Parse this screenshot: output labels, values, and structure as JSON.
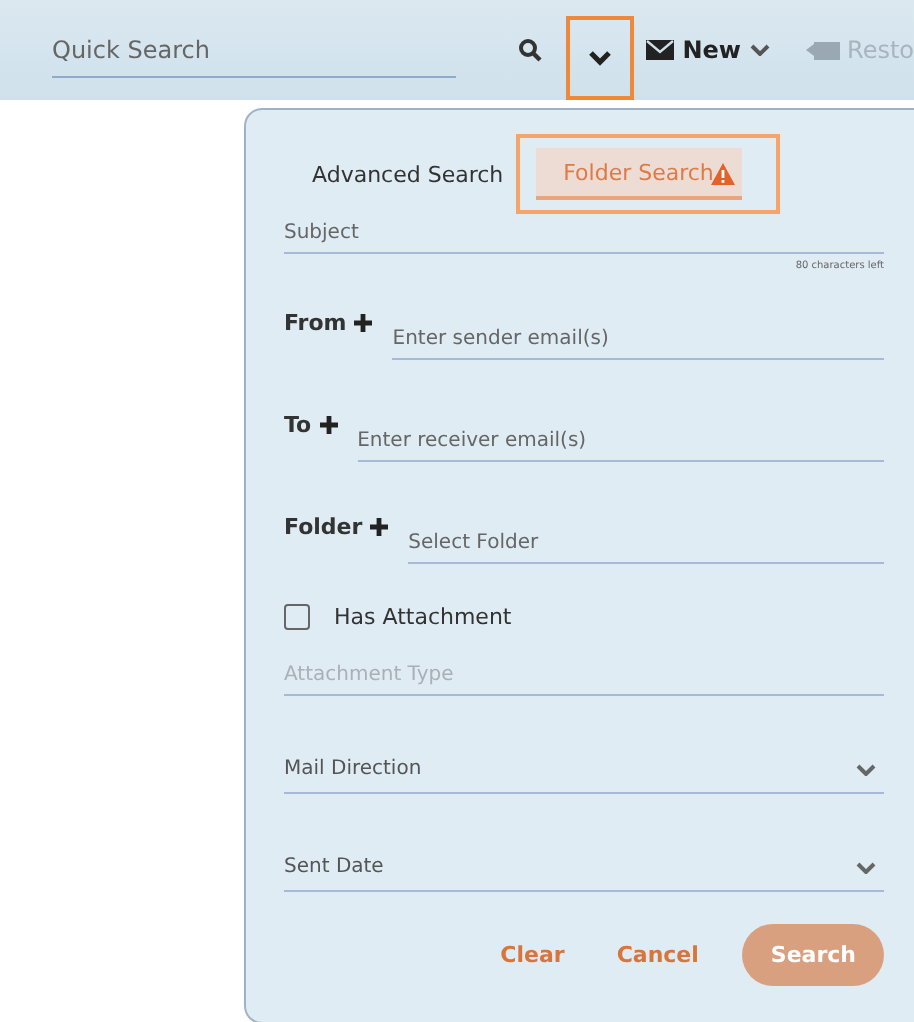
{
  "toolbar": {
    "quick_search": {
      "placeholder": "Quick Search"
    },
    "dropdown_button": {
      "highlighted": true
    },
    "new_button": {
      "label": "New"
    },
    "restore_button": {
      "label": "Resto",
      "disabled": true
    }
  },
  "panel": {
    "tabs": [
      {
        "label": "Advanced Search",
        "selected": false,
        "highlighted": false,
        "warning": false
      },
      {
        "label": "Folder Search",
        "selected": true,
        "highlighted": true,
        "warning": true
      }
    ],
    "subject": {
      "placeholder": "Subject",
      "counter": "80 characters left"
    },
    "fields": [
      {
        "kind": "input",
        "label": "From",
        "placeholder": "Enter sender email(s)"
      },
      {
        "kind": "input",
        "label": "To",
        "placeholder": "Enter receiver email(s)"
      },
      {
        "kind": "input",
        "label": "Folder",
        "placeholder": "Select Folder"
      },
      {
        "kind": "checkbox",
        "label": "Has Attachment",
        "checked": false
      },
      {
        "kind": "text",
        "placeholder": "Attachment Type"
      },
      {
        "kind": "select",
        "placeholder": "Mail Direction"
      },
      {
        "kind": "select",
        "placeholder": "Sent Date"
      }
    ],
    "buttons": [
      {
        "kind": "link",
        "label": "Clear",
        "disabled": false
      },
      {
        "kind": "link",
        "label": "Cancel",
        "disabled": false
      },
      {
        "kind": "primary",
        "label": "Search",
        "disabled": true
      }
    ]
  }
}
